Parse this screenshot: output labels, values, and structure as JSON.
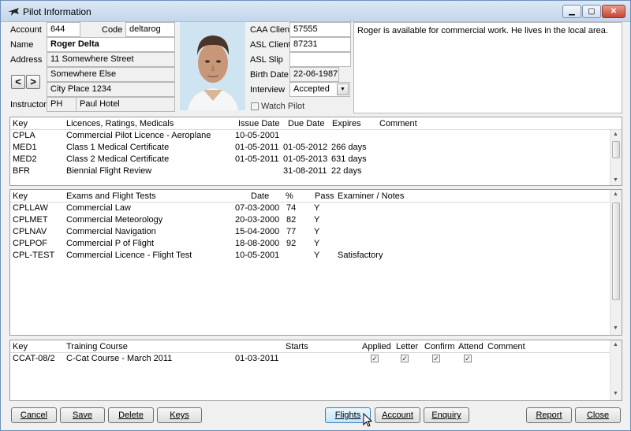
{
  "window": {
    "title": "Pilot Information",
    "min": "▁",
    "max": "▢",
    "close": "✕"
  },
  "form": {
    "account_label": "Account",
    "account": "644",
    "code_label": "Code",
    "code": "deltarog",
    "name_label": "Name",
    "name": "Roger Delta",
    "address_label": "Address",
    "address1": "11 Somewhere Street",
    "address2": "Somewhere Else",
    "address3": "City Place 1234",
    "prev": "<",
    "next": ">",
    "instructor_label": "Instructor",
    "instructor_code": "PH",
    "instructor_name": "Paul Hotel",
    "caa_label": "CAA Client",
    "caa": "57555",
    "asl_label": "ASL Client",
    "asl": "87231",
    "aslslip_label": "ASL Slip",
    "aslslip": "",
    "birth_label": "Birth Date",
    "birth": "22-06-1987",
    "interview_label": "Interview",
    "interview": "Accepted",
    "watch_label": "Watch Pilot",
    "notes": "Roger is available for commercial work. He lives in the local area."
  },
  "licences": {
    "headers": [
      "Key",
      "Licences, Ratings, Medicals",
      "Issue Date",
      "Due Date",
      "Expires",
      "Comment"
    ],
    "rows": [
      [
        "CPLA",
        "Commercial Pilot Licence - Aeroplane",
        "10-05-2001",
        "",
        "",
        ""
      ],
      [
        "MED1",
        "Class 1 Medical Certificate",
        "01-05-2011",
        "01-05-2012",
        "266 days",
        ""
      ],
      [
        "MED2",
        "Class 2 Medical Certificate",
        "01-05-2011",
        "01-05-2013",
        "631 days",
        ""
      ],
      [
        "BFR",
        "Biennial Flight Review",
        "",
        "31-08-2011",
        "22 days",
        ""
      ]
    ]
  },
  "exams": {
    "headers": [
      "Key",
      "Exams and Flight Tests",
      "Date",
      "%",
      "Pass",
      "Examiner / Notes"
    ],
    "rows": [
      [
        "CPLLAW",
        "Commercial Law",
        "07-03-2000",
        "74",
        "Y",
        ""
      ],
      [
        "CPLMET",
        "Commercial Meteorology",
        "20-03-2000",
        "82",
        "Y",
        ""
      ],
      [
        "CPLNAV",
        "Commercial Navigation",
        "15-04-2000",
        "77",
        "Y",
        ""
      ],
      [
        "CPLPOF",
        "Commercial P of Flight",
        "18-08-2000",
        "92",
        "Y",
        ""
      ],
      [
        "CPL-TEST",
        "Commercial Licence - Flight Test",
        "10-05-2001",
        "",
        "Y",
        "Satisfactory"
      ]
    ]
  },
  "training": {
    "headers": [
      "Key",
      "Training Course",
      "Starts",
      "Applied",
      "Letter",
      "Confirm",
      "Attend",
      "Comment"
    ],
    "rows": [
      {
        "key": "CCAT-08/2",
        "course": "C-Cat Course - March 2011",
        "starts": "01-03-2011",
        "applied": "✓",
        "letter": "✓",
        "confirm": "✓",
        "attend": "✓",
        "comment": ""
      }
    ]
  },
  "buttons": {
    "cancel": "Cancel",
    "save": "Save",
    "delete": "Delete",
    "keys": "Keys",
    "flights": "Flights",
    "account": "Account",
    "enquiry": "Enquiry",
    "report": "Report",
    "close": "Close"
  }
}
